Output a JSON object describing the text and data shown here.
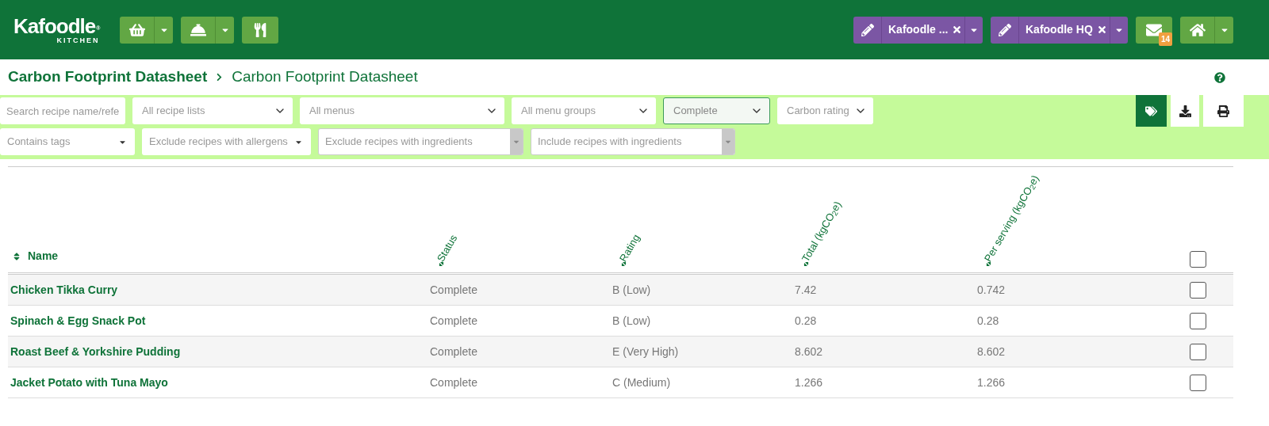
{
  "header": {
    "logo": {
      "name": "Kafoodle",
      "sub": "KITCHEN",
      "mark": "®"
    },
    "accounts": [
      {
        "label": "Kafoodle ..."
      },
      {
        "label": "Kafoodle HQ"
      }
    ],
    "mail_badge": "14"
  },
  "breadcrumb": {
    "parent": "Carbon Footprint Datasheet",
    "current": "Carbon Footprint Datasheet"
  },
  "filters": [
    [
      {
        "kind": "search",
        "placeholder": "Search recipe name/refe"
      },
      {
        "kind": "select",
        "placeholder": "All recipe lists"
      },
      {
        "kind": "select",
        "placeholder": "All menus"
      },
      {
        "kind": "select",
        "placeholder": "All menu groups"
      },
      {
        "kind": "select",
        "value": "Complete"
      },
      {
        "kind": "select",
        "placeholder": "Carbon rating"
      }
    ],
    [
      {
        "kind": "tags",
        "placeholder": "Contains tags"
      },
      {
        "kind": "tags",
        "placeholder": "Exclude recipes with allergens"
      },
      {
        "kind": "combo",
        "placeholder": "Exclude recipes with ingredients"
      },
      {
        "kind": "combo",
        "placeholder": "Include recipes with ingredients"
      }
    ]
  ],
  "toolbar": [
    {
      "kind": "tags",
      "selected": true
    },
    {
      "kind": "download",
      "selected": false
    },
    {
      "kind": "print",
      "selected": false
    }
  ],
  "table": {
    "columns": [
      "Name",
      "Status",
      "Rating",
      "Total (kgCO$_{2}$e)",
      "Per serving (kgCO$_{2}$e)"
    ],
    "select_all": {
      "checked": false
    },
    "rows": [
      {
        "cells": [
          "Chicken Tikka Curry",
          "Complete",
          "B (Low)",
          "7.42",
          "0.742"
        ],
        "checked": false
      },
      {
        "cells": [
          "Spinach & Egg Snack Pot",
          "Complete",
          "B (Low)",
          "0.28",
          "0.28"
        ],
        "checked": false
      },
      {
        "cells": [
          "Roast Beef & Yorkshire Pudding",
          "Complete",
          "E (Very High)",
          "8.602",
          "8.602"
        ],
        "checked": false
      },
      {
        "cells": [
          "Jacket Potato with Tuna Mayo",
          "Complete",
          "C (Medium)",
          "1.266",
          "1.266"
        ],
        "checked": false
      }
    ]
  }
}
